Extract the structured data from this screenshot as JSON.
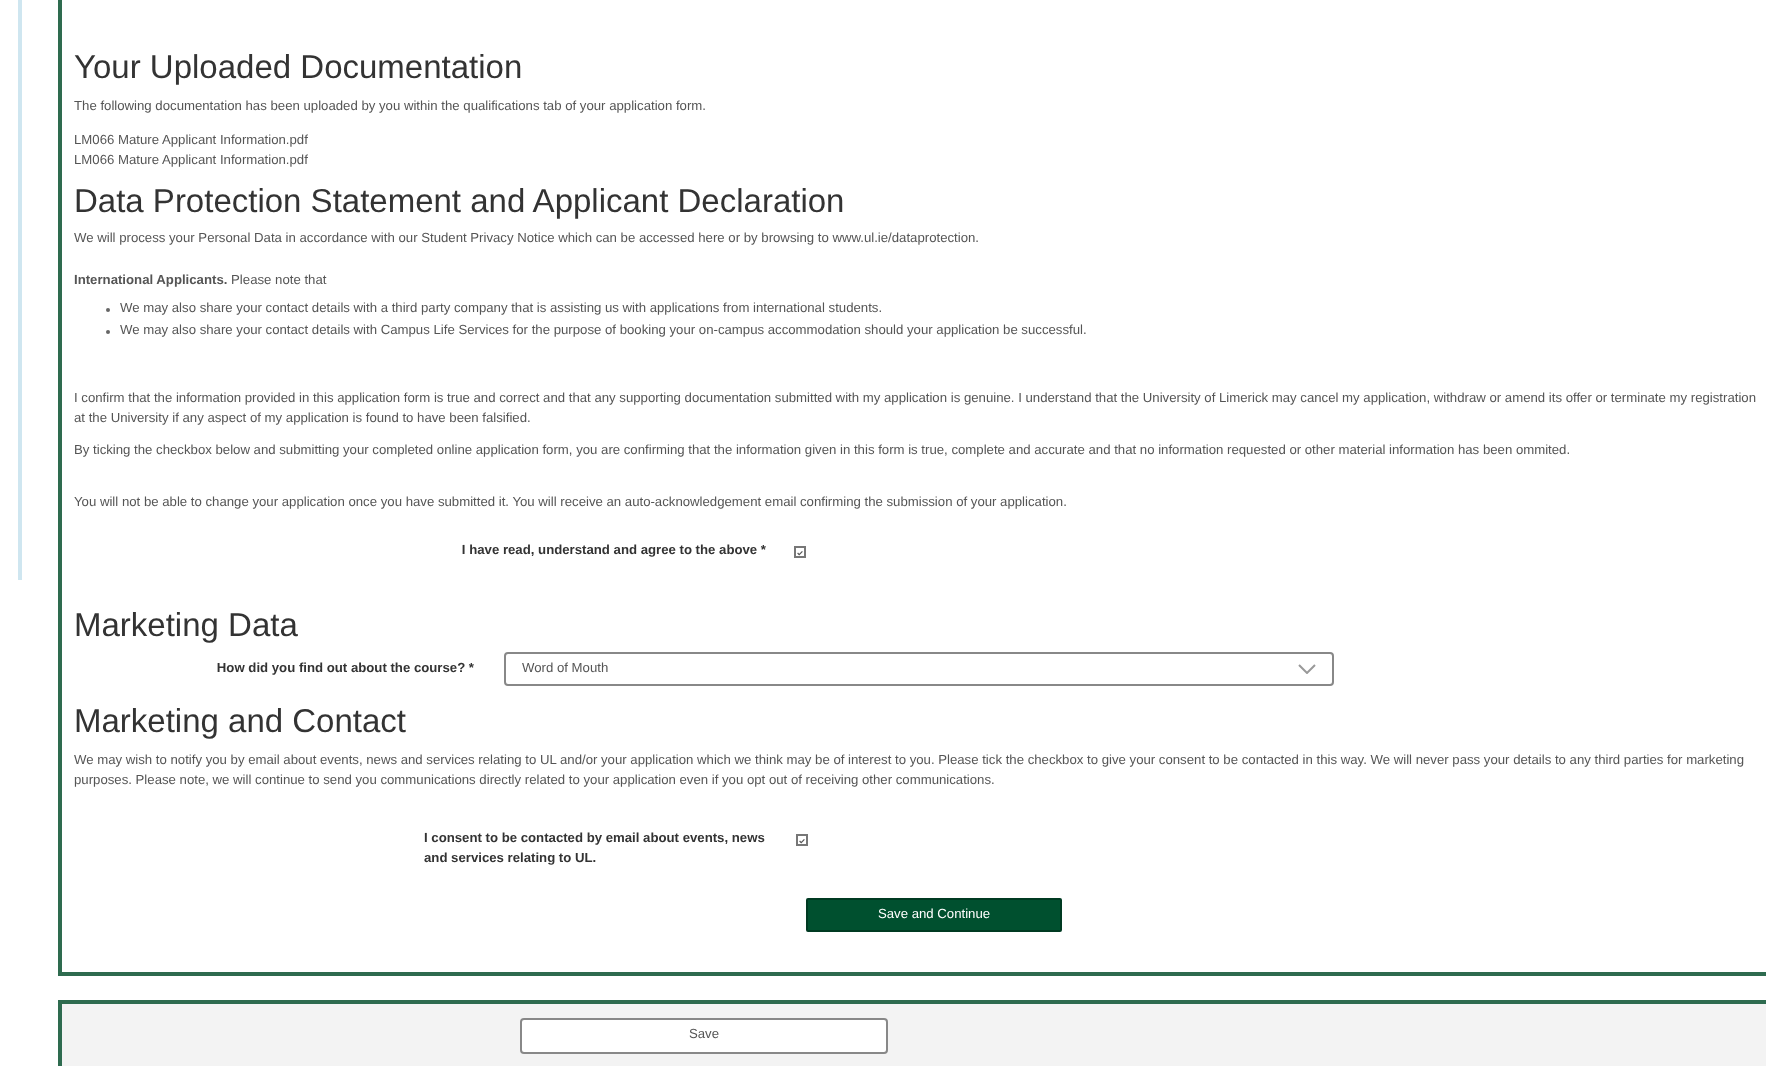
{
  "uploaded": {
    "title": "Your Uploaded Documentation",
    "intro": "The following documentation has been uploaded by you within the qualifications tab of your application form.",
    "files": [
      "LM066 Mature Applicant Information.pdf",
      "LM066 Mature Applicant Information.pdf"
    ]
  },
  "data_protection": {
    "title": "Data Protection Statement and Applicant Declaration",
    "statement": "We will process your Personal Data in accordance with our Student Privacy Notice which can be accessed here or by browsing to www.ul.ie/dataprotection.",
    "intl_note": "**International Applicants.** Please note that",
    "bullets": [
      "We may also share your contact details with a third party company that is assisting us with applications from international students.",
      "We may also share your contact details with Campus Life Services for the purpose of booking your on-campus accommodation should your application be successful."
    ],
    "paragraphs": [
      "I confirm that the information provided in this application form is true and correct and that any supporting documentation submitted with my application is genuine. I understand that the University of Limerick may cancel my application, withdraw or amend its offer or terminate my registration at the University if any aspect of my application is found to have been falsified.",
      "By ticking the checkbox below and submitting your completed online application form, you are confirming that the information given in this form is true, complete and accurate and that no information requested or other material information has been ommited.",
      "You will not be able to change your application once you have submitted it. You will receive an auto-acknowledgement email confirming the submission of your application."
    ],
    "agree": {
      "label": "I have read, understand and agree to the above *",
      "checked": true
    }
  },
  "marketing_data": {
    "title": "Marketing Data",
    "question": {
      "label": "How did you find out about the course? *",
      "value": "Word of Mouth"
    }
  },
  "marketing_contact": {
    "title": "Marketing and Contact",
    "text": "We may wish to notify you by email about events, news and services relating to UL and/or your application which we think may be of interest to you. Please tick the checkbox to give your consent to be contacted in this way. We will never pass your details to any third parties for marketing purposes. Please note, we will continue to send you communications directly related to your application even if you opt out of receiving other communications.",
    "consent": {
      "label": "I consent to be contacted by email about events, news and services relating to UL.",
      "checked": true
    }
  },
  "save_continue_button": "Save and Continue",
  "save_button": "Save"
}
